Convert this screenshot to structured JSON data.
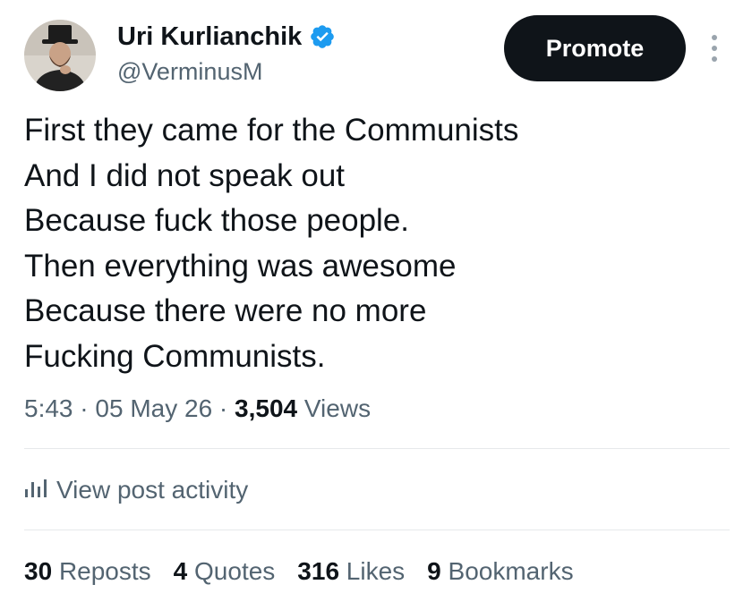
{
  "author": {
    "display_name": "Uri Kurlianchik",
    "handle": "@VerminusM",
    "verified": true,
    "verified_color": "#1d9bf0"
  },
  "promote_label": "Promote",
  "tweet": {
    "lines": [
      "First they came for the Communists",
      "And I did not speak out",
      "Because fuck those people.",
      "Then everything was awesome",
      "Because there were no more",
      "Fucking Communists."
    ],
    "time": "5:43",
    "separator": "·",
    "date": "05 May 26",
    "views_count": "3,504",
    "views_label": "Views"
  },
  "activity_label": "View post activity",
  "stats": [
    {
      "count": "30",
      "label": "Reposts"
    },
    {
      "count": "4",
      "label": "Quotes"
    },
    {
      "count": "316",
      "label": "Likes"
    },
    {
      "count": "9",
      "label": "Bookmarks"
    }
  ],
  "icons": {
    "avatar": "profile-photo",
    "verified": "verified-badge-icon",
    "more": "more-vertical-icon",
    "activity": "bar-chart-icon"
  },
  "colors": {
    "text_primary": "#0f1419",
    "text_secondary": "#536471",
    "promote_bg": "#0f1419",
    "divider": "#e6e9eb"
  }
}
